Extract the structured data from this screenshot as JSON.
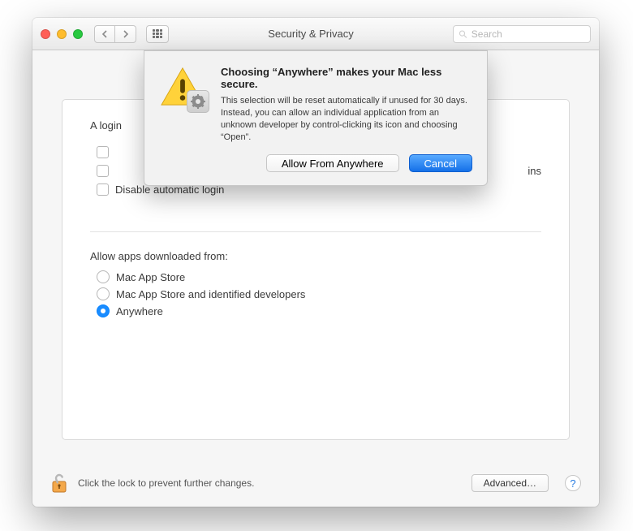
{
  "titlebar": {
    "title": "Security & Privacy",
    "search_placeholder": "Search"
  },
  "pane": {
    "login_label": "A login",
    "checkboxes": {
      "c1_label_fragment": "",
      "c2_trailing": "ins",
      "c3_label": "Disable automatic login"
    },
    "section_label": "Allow apps downloaded from:",
    "radios": {
      "r1": "Mac App Store",
      "r2": "Mac App Store and identified developers",
      "r3": "Anywhere",
      "selected_index": 2
    }
  },
  "footer": {
    "lock_text": "Click the lock to prevent further changes.",
    "advanced_label": "Advanced…"
  },
  "dialog": {
    "heading": "Choosing “Anywhere” makes your Mac less secure.",
    "body": "This selection will be reset automatically if unused for 30 days. Instead, you can allow an individual application from an unknown developer by control-clicking its icon and choosing “Open”.",
    "allow_label": "Allow From Anywhere",
    "cancel_label": "Cancel"
  }
}
